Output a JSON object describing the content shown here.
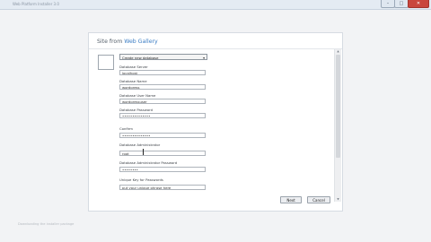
{
  "window": {
    "title": "Web Platform Installer 3.0",
    "minimize_glyph": "–",
    "maximize_glyph": "□",
    "close_glyph": "✕"
  },
  "dialog": {
    "title_prefix": "Site from ",
    "title_accent": "Web Gallery",
    "database_option": "Create new database",
    "dropdown_arrow": "▾",
    "fields": [
      {
        "label": "Database Server",
        "value": "localhost"
      },
      {
        "label": "Database Name",
        "value": "wordpress"
      },
      {
        "label": "Database User Name",
        "value": "wordpressuser"
      },
      {
        "label": "Database Password",
        "value": "••••••••••••••"
      },
      {
        "label": "Confirm",
        "value": "••••••••••••••"
      },
      {
        "label": "Database Administrator",
        "value": "root"
      },
      {
        "label": "Database Administrator Password",
        "value": "••••••••"
      },
      {
        "label": "Unique Key for Passwords",
        "value": "put your unique phrase here"
      }
    ],
    "scroll_up": "▲",
    "scroll_down": "▼"
  },
  "buttons": {
    "next": "Next",
    "cancel": "Cancel"
  },
  "status_text": "Downloading the installer package"
}
